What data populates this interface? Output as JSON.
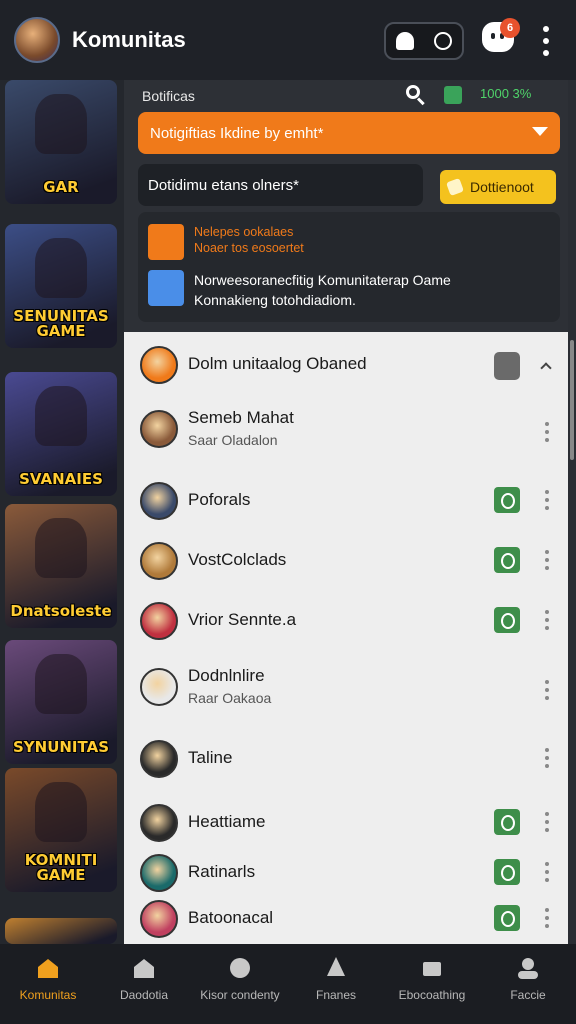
{
  "header": {
    "title": "Komunitas",
    "badge": "6"
  },
  "notifications": {
    "title": "Botificas",
    "status": "1000 3%",
    "dropdown_label": "Notigiftias Ikdine by emht*",
    "input_value": "Dotidimu etans olners*",
    "confirm_button": "Dottienoot",
    "alerts": [
      {
        "title": "Nelepes ookalaes",
        "subtitle": "Noaer tos eosoertet",
        "color": "#f07a1a"
      },
      {
        "title": "Norweesoranecfitig Komunitaterap Oame",
        "subtitle": "Konnakieng totohdiadiom.",
        "color": "#4a8ee8"
      }
    ]
  },
  "sidebar": {
    "cards": [
      {
        "label": "GAR",
        "bg": "#3a4a6a"
      },
      {
        "label": "SENUNITAS GAME",
        "bg": "#3c4e86"
      },
      {
        "label": "SVANAIES",
        "bg": "#4a4a92"
      },
      {
        "label": "Dnatsoleste",
        "bg": "#8a5a3a"
      },
      {
        "label": "SYNUNITAS",
        "bg": "#6a4a7a"
      },
      {
        "label": "KOMNITI GAME",
        "bg": "#7a4a2a"
      },
      {
        "label": "",
        "bg": "#c08030"
      }
    ]
  },
  "list": {
    "items": [
      {
        "name": "Dolm unitaalog Obaned",
        "sub": "",
        "avatar_color": "#f07a1a",
        "action": "gray"
      },
      {
        "name": "Semeb Mahat",
        "sub": "Saar Oladalon",
        "avatar_color": "#8a5a3a",
        "action": "none"
      },
      {
        "name": "Poforals",
        "sub": "",
        "avatar_color": "#3a4a6a",
        "action": "check"
      },
      {
        "name": "VostColclads",
        "sub": "",
        "avatar_color": "#b07a3a",
        "action": "check"
      },
      {
        "name": "Vrior Sennte.a",
        "sub": "",
        "avatar_color": "#c03040",
        "action": "check"
      },
      {
        "name": "Dodnlnlire",
        "sub": "Raar Oakaoa",
        "avatar_color": "#e8e8e8",
        "action": "none"
      },
      {
        "name": "Taline",
        "sub": "",
        "avatar_color": "#2a2a2a",
        "action": "none"
      },
      {
        "name": "Heattiame",
        "sub": "",
        "avatar_color": "#2a2a2a",
        "action": "check"
      },
      {
        "name": "Ratinarls",
        "sub": "",
        "avatar_color": "#1a6a6a",
        "action": "check"
      },
      {
        "name": "Batoonacal",
        "sub": "",
        "avatar_color": "#c04060",
        "action": "check"
      }
    ]
  },
  "bottom_nav": {
    "items": [
      {
        "label": "Komunitas",
        "icon": "home-icon"
      },
      {
        "label": "Daodotia",
        "icon": "home-outline-icon"
      },
      {
        "label": "Kisor condenty",
        "icon": "compass-icon"
      },
      {
        "label": "Fnanes",
        "icon": "tree-icon"
      },
      {
        "label": "Ebocoathing",
        "icon": "cup-icon"
      },
      {
        "label": "Faccie",
        "icon": "profile-icon"
      }
    ]
  },
  "colors": {
    "accent": "#f07a1a",
    "confirm": "#f4c21e",
    "check": "#3e8e4a",
    "active_nav": "#f0a01e"
  }
}
